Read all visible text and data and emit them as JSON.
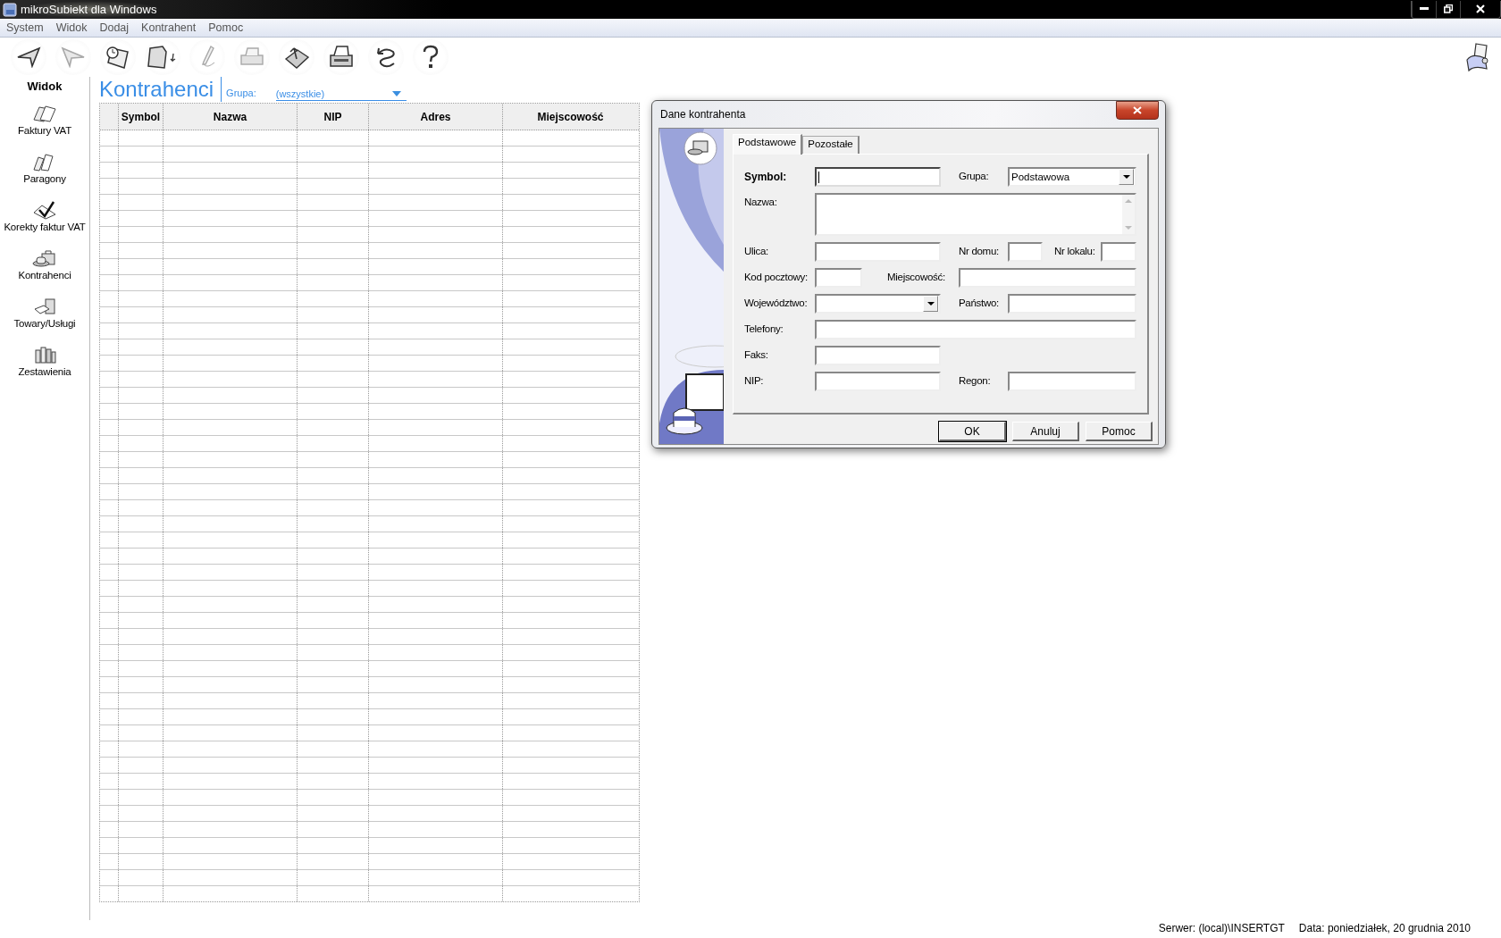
{
  "window": {
    "title": "mikroSubiekt dla Windows"
  },
  "menu": [
    "System",
    "Widok",
    "Dodaj",
    "Kontrahent",
    "Pomoc"
  ],
  "toolbar": [
    {
      "kind": "back",
      "disabled": false
    },
    {
      "kind": "forward",
      "disabled": true
    },
    {
      "kind": "clipboard",
      "disabled": false
    },
    {
      "kind": "new",
      "disabled": false
    },
    {
      "kind": "pen",
      "disabled": true
    },
    {
      "kind": "print-preview",
      "disabled": true
    },
    {
      "kind": "export",
      "disabled": false
    },
    {
      "kind": "print",
      "disabled": false
    },
    {
      "kind": "undo",
      "disabled": false
    },
    {
      "kind": "help",
      "disabled": false
    }
  ],
  "sidebar": {
    "title": "Widok",
    "items": [
      {
        "label": "Faktury VAT",
        "kind": "invoice"
      },
      {
        "label": "Paragony",
        "kind": "receipt"
      },
      {
        "label": "Korekty faktur VAT",
        "kind": "correction"
      },
      {
        "label": "Kontrahenci",
        "kind": "contractor"
      },
      {
        "label": "Towary/Usługi",
        "kind": "goods"
      },
      {
        "label": "Zestawienia",
        "kind": "reports"
      }
    ]
  },
  "page": {
    "title": "Kontrahenci",
    "filter": {
      "label": "Grupa:",
      "value": "(wszystkie)"
    }
  },
  "table": {
    "columns": [
      "Symbol",
      "Nazwa",
      "NIP",
      "Adres",
      "Miejscowość"
    ]
  },
  "dialog": {
    "title": "Dane kontrahenta",
    "tabs": [
      {
        "label": "Podstawowe",
        "selected": true
      },
      {
        "label": "Pozostałe",
        "selected": false
      }
    ],
    "rows": [
      [
        {
          "label": "Symbol:",
          "kind": "text",
          "required": true,
          "focused": true
        },
        {
          "label": "Grupa:",
          "kind": "combo",
          "value": "Podstawowa",
          "required": false
        }
      ],
      [
        {
          "label": "Nazwa:",
          "kind": "textarea",
          "required": false
        }
      ],
      [
        {
          "label": "Ulica:",
          "kind": "text",
          "required": false
        },
        {
          "label": "Nr domu:",
          "kind": "text",
          "required": false
        },
        {
          "label": "Nr lokalu:",
          "kind": "text",
          "required": false
        }
      ],
      [
        {
          "label": "Kod pocztowy:",
          "kind": "text",
          "required": false
        },
        {
          "label": "Miejscowość:",
          "kind": "text",
          "required": false
        }
      ],
      [
        {
          "label": "Województwo:",
          "kind": "combo",
          "required": false
        },
        {
          "label": "Państwo:",
          "kind": "text",
          "required": false
        }
      ],
      [
        {
          "label": "Telefony:",
          "kind": "text",
          "required": false
        }
      ],
      [
        {
          "label": "Faks:",
          "kind": "text",
          "required": false
        }
      ],
      [
        {
          "label": "NIP:",
          "kind": "text",
          "required": false
        },
        {
          "label": "Regon:",
          "kind": "text",
          "required": false
        }
      ]
    ],
    "buttons": [
      {
        "label": "OK",
        "default": true
      },
      {
        "label": "Anuluj",
        "default": false
      },
      {
        "label": "Pomoc",
        "default": false
      }
    ]
  },
  "status_bar": {
    "server": "Serwer: (local)\\INSERTGT",
    "date": "Data: poniedziałek, 20 grudnia 2010"
  }
}
